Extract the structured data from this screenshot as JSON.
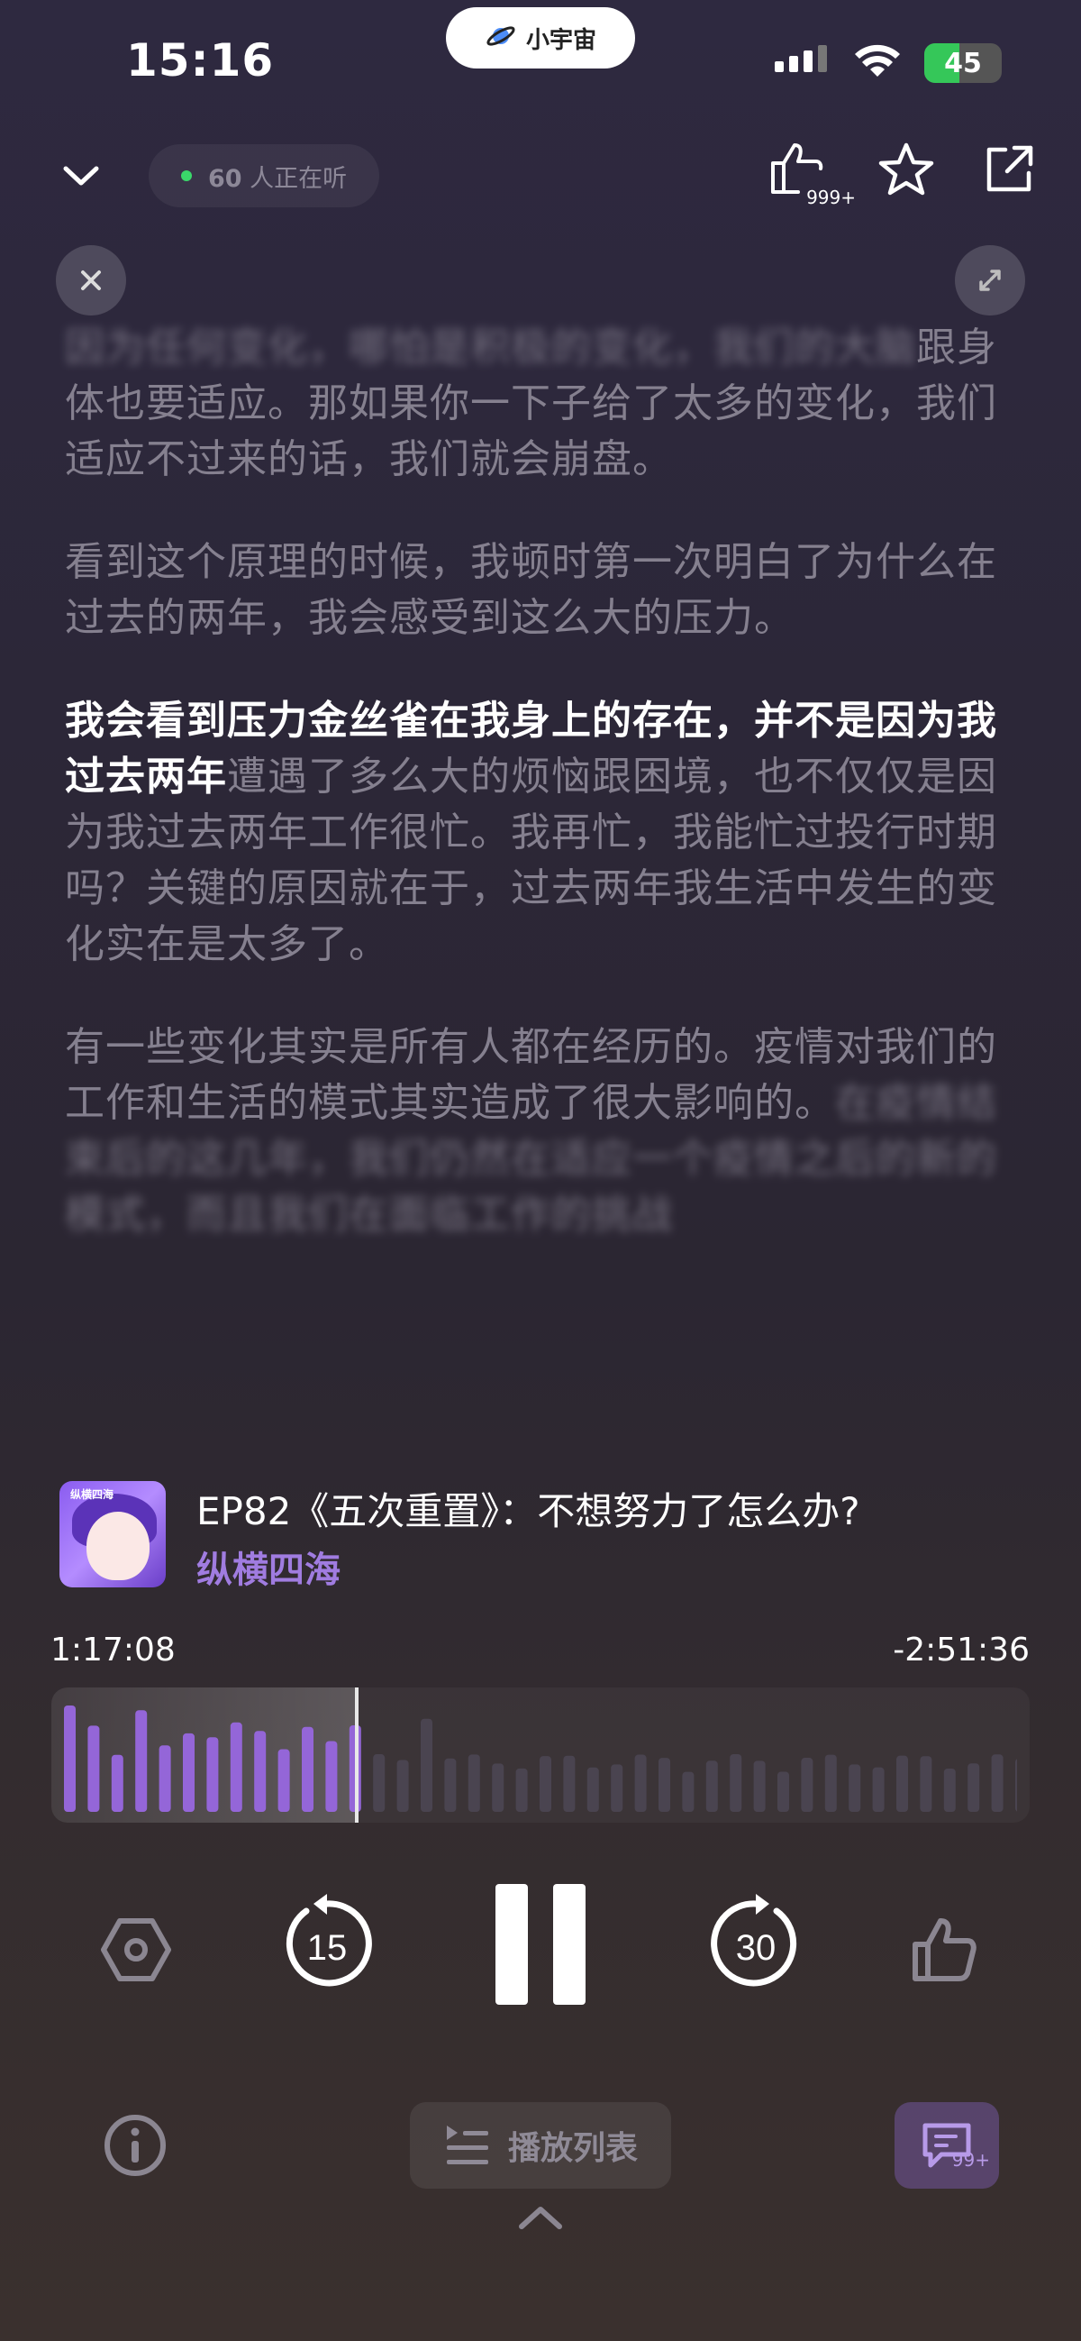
{
  "status_bar": {
    "time": "15:16",
    "island_label": "小宇宙",
    "battery": "45"
  },
  "nav": {
    "listeners_count": "60",
    "listeners_suffix": "人正在听",
    "like_count": "999+"
  },
  "transcript": {
    "paragraphs": [
      {
        "blurred_line": "因为任何变化，哪怕是积极的变化，我们的大脑",
        "text": "跟身体也要适应。那如果你一下子给了太多的变化，我们适应不过来的话，我们就会崩盘。"
      },
      {
        "text": "看到这个原理的时候，我顿时第一次明白了为什么在过去的两年，我会感受到这么大的压力。"
      },
      {
        "highlight": "我会看到压力金丝雀在我身上的存在，并不是因为我过去两年",
        "text": "遭遇了多么大的烦恼跟困境，也不仅仅是因为我过去两年工作很忙。我再忙，我能忙过投行时期吗？关键的原因就在于，过去两年我生活中发生的变化实在是太多了。"
      },
      {
        "text": "有一些变化其实是所有人都在经历的。疫情对我们的工作和生活的模式其实造成了很大影响的。",
        "blurred_line": "在疫情结束后的这几年，我们仍然在适应一个疫情之后的新的模式，而且我们在面临工作的挑战"
      }
    ]
  },
  "episode": {
    "title": "EP82《五次重置》：不想努力了怎么办?",
    "podcast": "纵横四海",
    "cover_text": "纵横四海"
  },
  "progress": {
    "elapsed": "1:17:08",
    "remaining": "-2:51:36",
    "played_fraction": 0.31
  },
  "controls": {
    "rewind_seconds": "15",
    "forward_seconds": "30"
  },
  "bottom_bar": {
    "playlist_label": "播放列表",
    "comment_count": "99+"
  },
  "colors": {
    "accent": "#9b6fe0",
    "wave_played": "#9466d8",
    "wave_unplayed": "#4a4450"
  }
}
